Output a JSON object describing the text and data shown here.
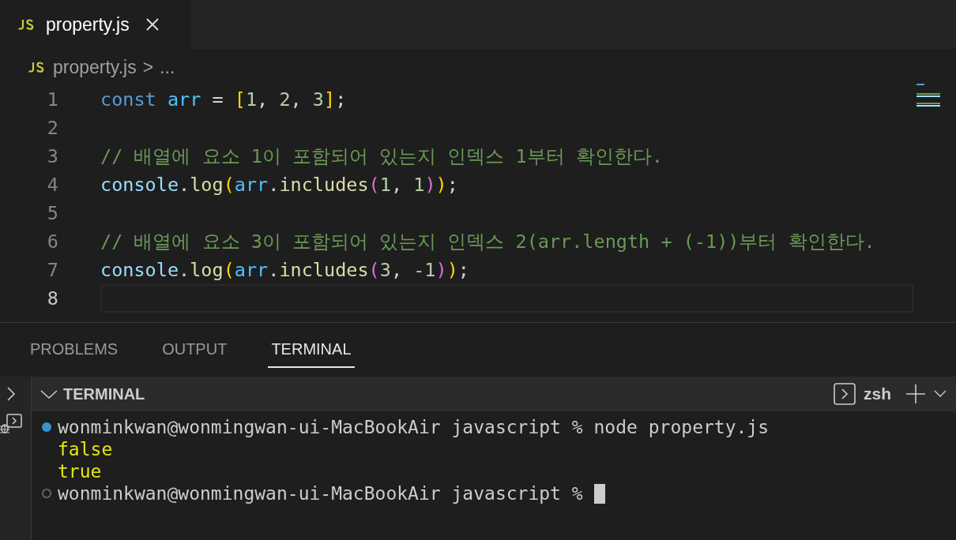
{
  "editor_tabs": [
    {
      "label": "property.js",
      "selected": true
    }
  ],
  "breadcrumb": {
    "file": "property.js",
    "separator": ">",
    "rest": "..."
  },
  "code_lines": [
    {
      "number": "1",
      "current": false,
      "tokens": [
        {
          "kind": "keyword",
          "text": "const"
        },
        {
          "kind": "constant",
          "text": " arr"
        },
        {
          "kind": "plain",
          "text": " = "
        },
        {
          "kind": "bracket1",
          "text": "["
        },
        {
          "kind": "number",
          "text": "1"
        },
        {
          "kind": "plain",
          "text": ", "
        },
        {
          "kind": "number",
          "text": "2"
        },
        {
          "kind": "plain",
          "text": ", "
        },
        {
          "kind": "number",
          "text": "3"
        },
        {
          "kind": "bracket1",
          "text": "]"
        },
        {
          "kind": "plain",
          "text": ";"
        }
      ]
    },
    {
      "number": "2",
      "current": false
    },
    {
      "number": "3",
      "current": false,
      "tokens": [
        {
          "kind": "comment",
          "text": "// 배열에 요소 1이 포함되어 있는지 인덱스 1부터 확인한다."
        }
      ]
    },
    {
      "number": "4",
      "current": false,
      "tokens": [
        {
          "kind": "variable",
          "text": "console"
        },
        {
          "kind": "plain",
          "text": "."
        },
        {
          "kind": "function",
          "text": "log"
        },
        {
          "kind": "bracket1",
          "text": "("
        },
        {
          "kind": "constant",
          "text": "arr"
        },
        {
          "kind": "plain",
          "text": "."
        },
        {
          "kind": "function",
          "text": "includes"
        },
        {
          "kind": "bracket2",
          "text": "("
        },
        {
          "kind": "number",
          "text": "1"
        },
        {
          "kind": "plain",
          "text": ", "
        },
        {
          "kind": "number",
          "text": "1"
        },
        {
          "kind": "bracket2",
          "text": ")"
        },
        {
          "kind": "bracket1",
          "text": ")"
        },
        {
          "kind": "plain",
          "text": ";"
        }
      ]
    },
    {
      "number": "5",
      "current": false
    },
    {
      "number": "6",
      "current": false,
      "tokens": [
        {
          "kind": "comment",
          "text": "// 배열에 요소 3이 포함되어 있는지 인덱스 2(arr.length + (-1))부터 확인한다."
        }
      ]
    },
    {
      "number": "7",
      "current": false,
      "tokens": [
        {
          "kind": "variable",
          "text": "console"
        },
        {
          "kind": "plain",
          "text": "."
        },
        {
          "kind": "function",
          "text": "log"
        },
        {
          "kind": "bracket1",
          "text": "("
        },
        {
          "kind": "constant",
          "text": "arr"
        },
        {
          "kind": "plain",
          "text": "."
        },
        {
          "kind": "function",
          "text": "includes"
        },
        {
          "kind": "bracket2",
          "text": "("
        },
        {
          "kind": "number",
          "text": "3"
        },
        {
          "kind": "plain",
          "text": ", "
        },
        {
          "kind": "number",
          "text": "-1"
        },
        {
          "kind": "bracket2",
          "text": ")"
        },
        {
          "kind": "bracket1",
          "text": ")"
        },
        {
          "kind": "plain",
          "text": ";"
        }
      ]
    },
    {
      "number": "8",
      "current": true
    }
  ],
  "panel_tabs": [
    {
      "label": "PROBLEMS",
      "selected": false
    },
    {
      "label": "OUTPUT",
      "selected": false
    },
    {
      "label": "TERMINAL",
      "selected": true
    }
  ],
  "terminal": {
    "title": "TERMINAL",
    "expanded": true,
    "shell": "zsh",
    "lines": [
      {
        "kind": "prompt",
        "success": true,
        "text": "wonminkwan@wonmingwan-ui-MacBookAir javascript % node property.js"
      },
      {
        "kind": "output",
        "text": "false"
      },
      {
        "kind": "output",
        "text": "true"
      },
      {
        "kind": "prompt",
        "success": false,
        "text": "wonminkwan@wonmingwan-ui-MacBookAir javascript % ",
        "cursor": true
      }
    ]
  }
}
